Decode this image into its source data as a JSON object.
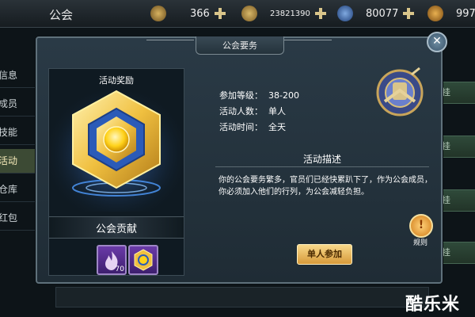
{
  "topbar": {
    "title": "公会",
    "resources": [
      {
        "value": "366"
      },
      {
        "value": "23821390"
      },
      {
        "value": "80077"
      },
      {
        "value": "997"
      }
    ]
  },
  "sidebar": {
    "items": [
      "信息",
      "成员",
      "技能",
      "活动",
      "仓库",
      "红包"
    ],
    "active": "活动"
  },
  "right_buttons": [
    "挂",
    "挂",
    "挂",
    "挂"
  ],
  "modal": {
    "title": "公会要务",
    "reward_header": "活动奖励",
    "reward_name": "公会贡献",
    "items": [
      {
        "count": "70"
      },
      {
        "count": ""
      }
    ],
    "info": [
      {
        "label": "参加等级：",
        "value": "38-200"
      },
      {
        "label": "活动人数：",
        "value": "单人"
      },
      {
        "label": "活动时间：",
        "value": "全天"
      }
    ],
    "desc_title": "活动描述",
    "desc_text": "你的公会要务繁多，官员们已经快累趴下了，作为公会成员，你必须加入他们的行列，为公会减轻负担。",
    "rules_label": "规则",
    "join_label": "单人参加",
    "close_glyph": "✕"
  },
  "watermark": "酷乐米",
  "colors": {
    "accent_gold": "#f3c24a",
    "button_gold": "#e9b85a",
    "panel_bg": "#24323b"
  }
}
